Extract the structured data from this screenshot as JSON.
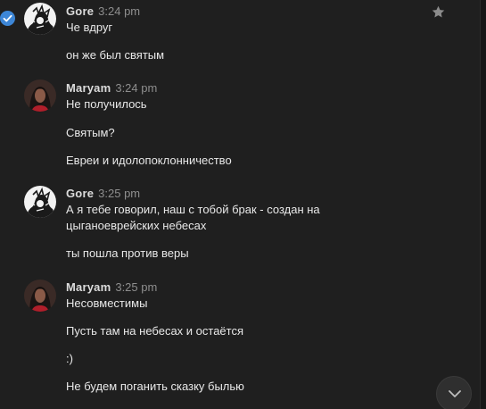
{
  "messages": [
    {
      "sender": "Gore",
      "time": "3:24 pm",
      "avatar": "gore-avatar",
      "lines": [
        "Че вдруг",
        "он же был святым"
      ]
    },
    {
      "sender": "Maryam",
      "time": "3:24 pm",
      "avatar": "maryam-avatar",
      "lines": [
        "Не получилось",
        "Святым?",
        "Евреи и идолопоклонничество"
      ]
    },
    {
      "sender": "Gore",
      "time": "3:25 pm",
      "avatar": "gore-avatar",
      "lines": [
        "А я тебе говорил, наш с тобой брак - создан на",
        "цыганоеврейских небесах",
        "ты пошла против веры"
      ]
    },
    {
      "sender": "Maryam",
      "time": "3:25 pm",
      "avatar": "maryam-avatar",
      "lines": [
        "Несовместимы",
        "Пусть там на небесах и остаётся",
        ":)",
        "Не будем поганить сказку былью"
      ]
    }
  ],
  "icons": {
    "selected": "check-circle-icon",
    "favorite": "star-icon",
    "scroll_down": "chevron-down-icon"
  },
  "colors": {
    "background": "#1f1f1f",
    "accent": "#3d86d6",
    "timestamp": "#8e8e8e"
  }
}
